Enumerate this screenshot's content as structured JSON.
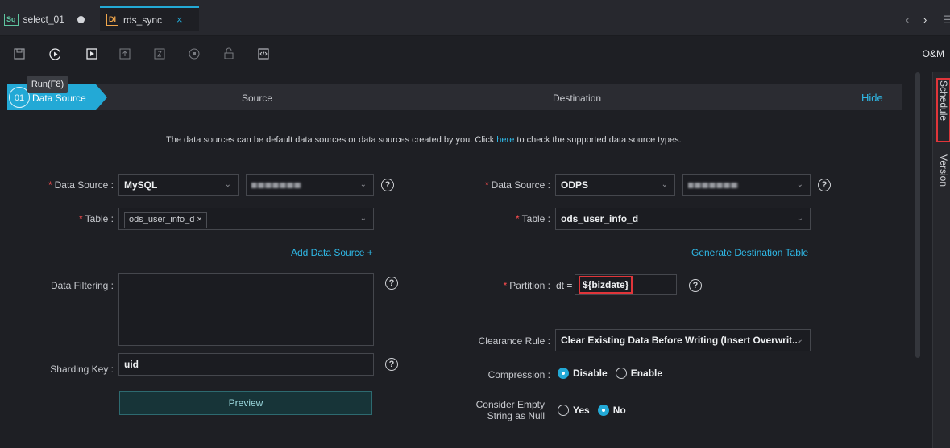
{
  "tabs": [
    {
      "badge": "Sq",
      "label": "select_01"
    },
    {
      "badge": "DI",
      "label": "rds_sync",
      "close": "×"
    }
  ],
  "nav": {
    "prev": "‹",
    "next": "›",
    "menu": "☰"
  },
  "toolbar": {
    "om_label": "O&M",
    "tooltip": "Run(F8)"
  },
  "steps": {
    "number": "01",
    "active_label": "Data Source",
    "source_label": "Source",
    "destination_label": "Destination",
    "hide_label": "Hide"
  },
  "info": {
    "before": "The data sources can be default data sources or data sources created by you. Click ",
    "link": "here",
    "after": " to check the supported data source types."
  },
  "source": {
    "data_source_label": "Data Source :",
    "data_source_type": "MySQL",
    "table_label": "Table :",
    "table_tag": "ods_user_info_d",
    "table_tag_close": "×",
    "add_data_source": "Add Data Source +",
    "filtering_label": "Data Filtering :",
    "sharding_label": "Sharding Key :",
    "sharding_value": "uid",
    "preview_label": "Preview"
  },
  "destination": {
    "data_source_label": "Data Source :",
    "data_source_type": "ODPS",
    "table_label": "Table :",
    "table_value": "ods_user_info_d",
    "generate_table": "Generate Destination Table",
    "partition_label": "Partition :",
    "partition_prefix": "dt =",
    "partition_value": "${bizdate}",
    "clearance_label": "Clearance Rule :",
    "clearance_value": "Clear Existing Data Before Writing (Insert Overwrit...",
    "compression_label": "Compression :",
    "compression_disable": "Disable",
    "compression_enable": "Enable",
    "empty_null_label_1": "Consider Empty",
    "empty_null_label_2": "String as Null",
    "empty_yes": "Yes",
    "empty_no": "No"
  },
  "side_tabs": {
    "schedule": "Schedule",
    "version": "Version"
  },
  "icons": {
    "help": "?",
    "chevron": "⌄"
  },
  "colors": {
    "accent": "#23a9d6",
    "highlight_border": "#e0353a",
    "required": "#ff4d4f"
  }
}
